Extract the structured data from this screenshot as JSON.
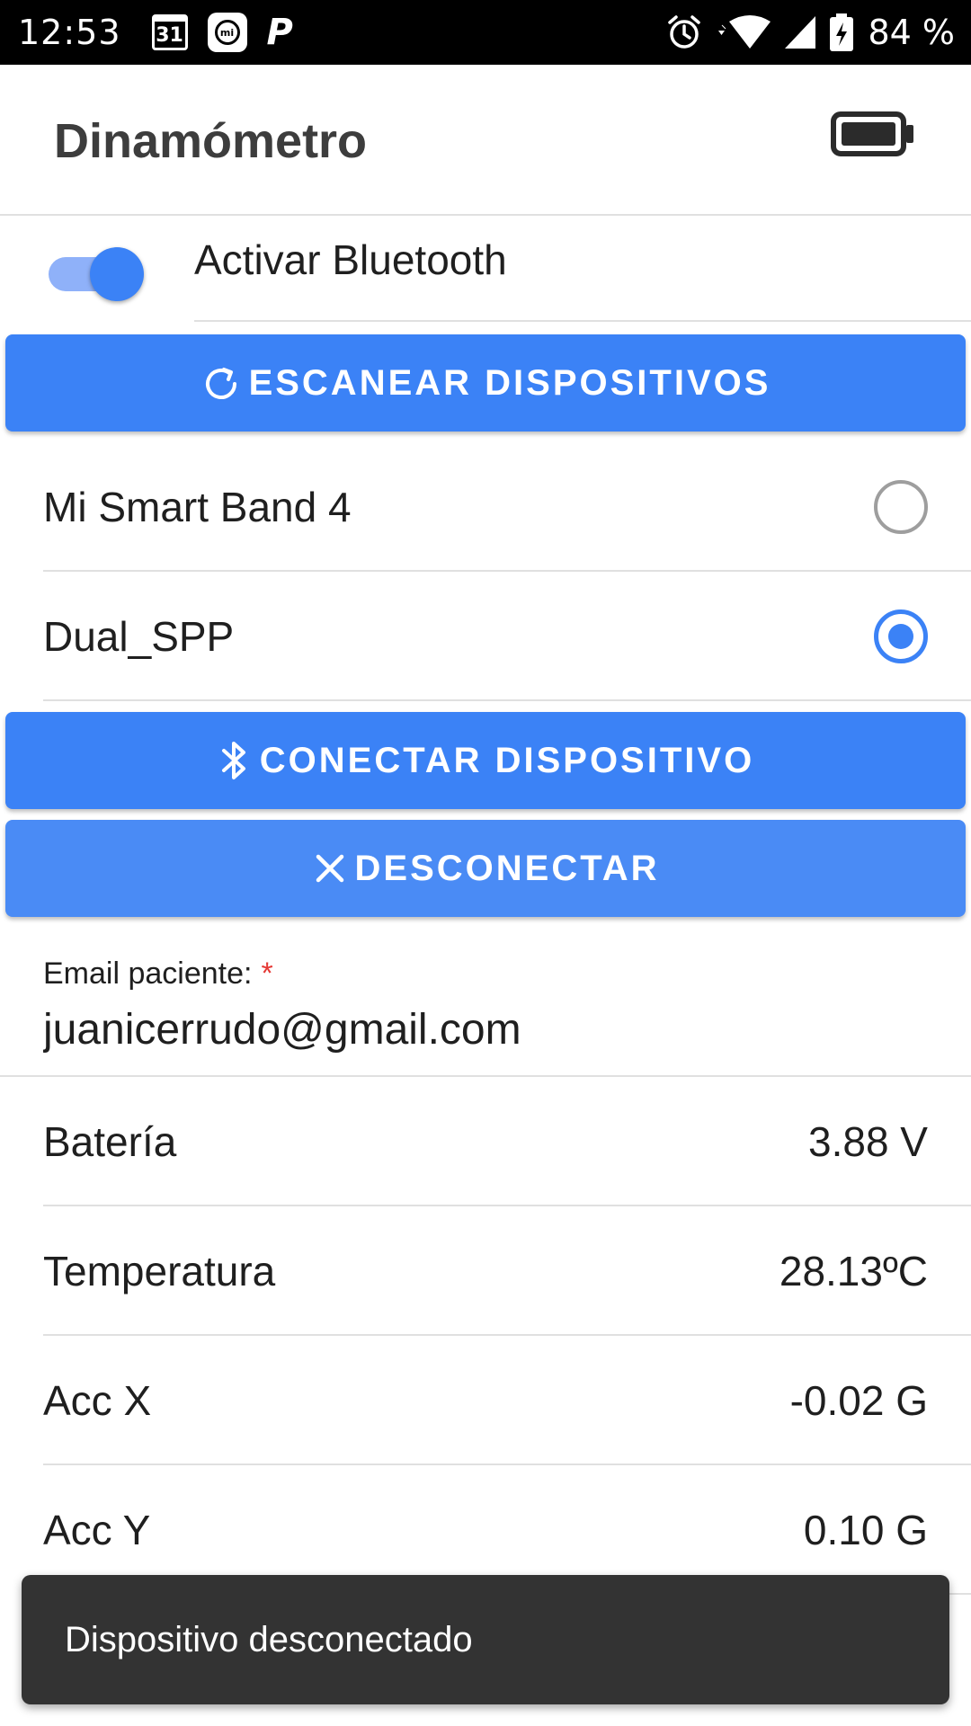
{
  "status_bar": {
    "time": "12:53",
    "calendar_day": "31",
    "mi_badge": "mi",
    "app_badge": "P",
    "battery_percent": "84 %"
  },
  "app_bar": {
    "title": "Dinamómetro",
    "battery_icon": "battery-icon"
  },
  "bluetooth": {
    "label": "Activar Bluetooth",
    "enabled": true
  },
  "buttons": {
    "scan": "ESCANEAR DISPOSITIVOS",
    "connect": "CONECTAR DISPOSITIVO",
    "disconnect": "DESCONECTAR"
  },
  "devices": [
    {
      "name": "Mi Smart Band 4",
      "selected": false
    },
    {
      "name": "Dual_SPP",
      "selected": true
    }
  ],
  "email": {
    "label": "Email paciente:",
    "required_mark": "*",
    "value": "juanicerrudo@gmail.com"
  },
  "readings": [
    {
      "label": "Batería",
      "value": "3.88 V"
    },
    {
      "label": "Temperatura",
      "value": "28.13ºC"
    },
    {
      "label": "Acc X",
      "value": "-0.02 G"
    },
    {
      "label": "Acc Y",
      "value": "0.10 G"
    }
  ],
  "toast": {
    "message": "Dispositivo desconectado"
  },
  "colors": {
    "accent": "#3b82f6",
    "toast_bg": "#333333",
    "required": "#e53935"
  }
}
